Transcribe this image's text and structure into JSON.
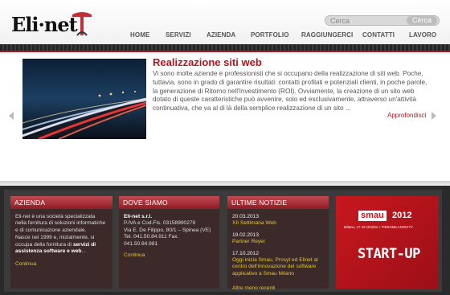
{
  "header": {
    "logo_text": "Eli·net",
    "search_placeholder": "Cerca",
    "search_button": "Cerca"
  },
  "nav": {
    "items": [
      {
        "label": "HOME"
      },
      {
        "label": "SERVIZI"
      },
      {
        "label": "AZIENDA"
      },
      {
        "label": "PORTFOLIO"
      },
      {
        "label": "RAGGIUNGERCI"
      },
      {
        "label": "CONTATTI"
      },
      {
        "label": "LAVORO"
      }
    ]
  },
  "slide": {
    "title": "Realizzazione siti web",
    "text": "Vi sono molte aziende e professionisti che si occupano della realizzazione di siti web. Poche, tuttavia, sono in grado di garantire risultati: contatti profilati e potenziali clienti, in poche parole, la generazione di Ritorno nell'Investimento (ROI). Ovviamente, la creazione di un sito web dotato di queste caratteristiche può avvenire, solo ed esclusivamente, attraverso un'attività continuativa, che va al di là della semplice realizzazione di un sito ...",
    "more": "Approfondisci"
  },
  "azienda": {
    "heading": "AZIENDA",
    "p1": "Eli-net è una società specializzata nella fornitura di soluzioni informatiche e di comunicazione aziendale.",
    "p2_pre": "Nasce nel 1999 e, inizialmente, si occupa della fornitura di ",
    "p2_bold": "servizi di assistenza software e web",
    "p2_post": "...",
    "link": "Continua"
  },
  "dove": {
    "heading": "DOVE SIAMO",
    "company": "Eli-net s.r.l.",
    "line1": "P.IVA e Cod.Fis. 03158990279",
    "line2": "Via E. De Filippo, 80/1 – Spinea (VE)",
    "line3": "Tel. 041.50.84.911 Fax. 041.50.84.981",
    "link": "Continua"
  },
  "notizie": {
    "heading": "ULTIME NOTIZIE",
    "items": [
      {
        "date": "20.03.2013",
        "title": "XII Settimana Web"
      },
      {
        "date": "19.02.2013",
        "title": "Partner Reyer"
      },
      {
        "date": "17.10.2012",
        "title": "Oggi inizia Smau, Prosyt ed Elinet al centro dell'innovazione del software applicativo a Smau Milano"
      }
    ],
    "more": "Altre meno recenti"
  },
  "banner": {
    "brand": "smau",
    "year": "2012",
    "subtitle": "Milano, 17-19 Ottobre • FIERAMILANOCITY",
    "tagline": "START-UP"
  },
  "colors": {
    "accent": "#b3151f",
    "link_yellow": "#e2c534"
  }
}
